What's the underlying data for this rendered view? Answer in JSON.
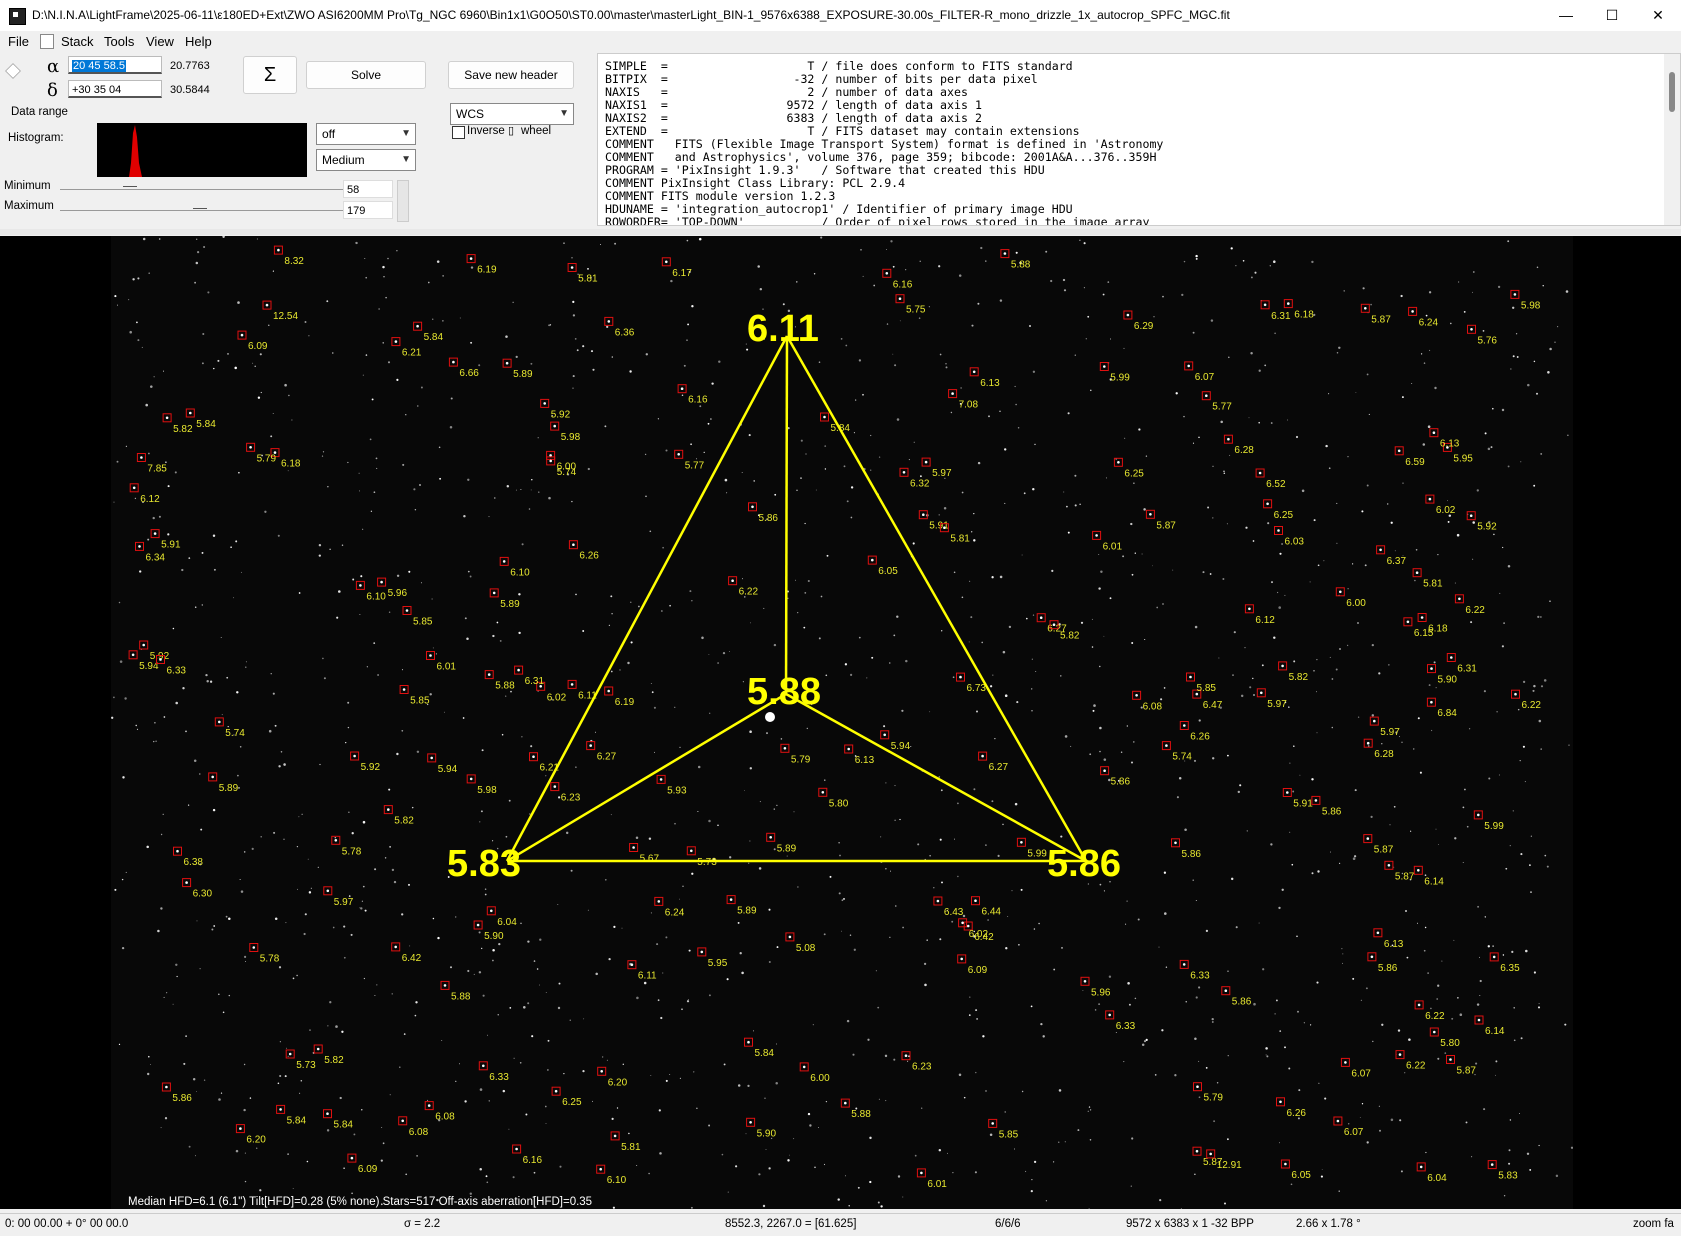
{
  "window": {
    "title": "D:\\N.I.N.A\\LightFrame\\2025-06-11\\ε180ED+Ext\\ZWO ASI6200MM Pro\\Tg_NGC 6960\\Bin1x1\\G0O50\\ST0.00\\master\\masterLight_BIN-1_9576x6388_EXPOSURE-30.00s_FILTER-R_mono_drizzle_1x_autocrop_SPFC_MGC.fit",
    "minimize": "—",
    "maximize": "☐",
    "close": "✕"
  },
  "menu": {
    "file": "File",
    "stack": "Stack",
    "tools": "Tools",
    "view": "View",
    "help": "Help"
  },
  "coords": {
    "alpha_symbol": "α",
    "delta_symbol": "δ",
    "ra_value": "20 45 58.5",
    "ra_deg": "20.7763",
    "dec_value": "+30 35 04",
    "dec_deg": "30.5844"
  },
  "buttons": {
    "sigma": "Σ",
    "solve": "Solve",
    "save_header": "Save new header"
  },
  "wcs_select": "WCS",
  "data_range": {
    "title": "Data range",
    "histogram_label": "Histogram:",
    "stretch": "off",
    "level": "Medium",
    "inverse_label": "Inverse",
    "wheel_label": "wheel",
    "minimum_label": "Minimum",
    "minimum_value": "58",
    "maximum_label": "Maximum",
    "maximum_value": "179"
  },
  "fits_header": [
    "SIMPLE  =                    T / file does conform to FITS standard",
    "BITPIX  =                  -32 / number of bits per data pixel",
    "NAXIS   =                    2 / number of data axes",
    "NAXIS1  =                 9572 / length of data axis 1",
    "NAXIS2  =                 6383 / length of data axis 2",
    "EXTEND  =                    T / FITS dataset may contain extensions",
    "COMMENT   FITS (Flexible Image Transport System) format is defined in 'Astronomy",
    "COMMENT   and Astrophysics', volume 376, page 359; bibcode: 2001A&A...376..359H",
    "PROGRAM = 'PixInsight 1.9.3'   / Software that created this HDU",
    "COMMENT PixInsight Class Library: PCL 2.9.4",
    "COMMENT FITS module version 1.2.3",
    "HDUNAME = 'integration_autocrop1' / Identifier of primary image HDU",
    "ROWORDER= 'TOP-DOWN'           / Order of pixel rows stored in the image array"
  ],
  "tilt": {
    "top_value": "6.11",
    "center_value": "5.88",
    "left_value": "5.83",
    "right_value": "5.86",
    "line_color": "#ffff00"
  },
  "star_labels": [
    "6.05",
    "6.44",
    "6.32",
    "6.33",
    "6.52",
    "6.26",
    "6.22",
    "6.10",
    "6.84",
    "6.73",
    "6.09",
    "6.23",
    "6.22",
    "6.59",
    "6.30",
    "6.42",
    "6.43",
    "6.12",
    "5.82",
    "6.02",
    "6.01",
    "6.18",
    "6.17",
    "6.07",
    "6.00",
    "6.13",
    "6.47",
    "6.23",
    "6.31",
    "6.34",
    "6.27",
    "6.29",
    "6.21",
    "5.87",
    "5.98",
    "5.92",
    "5.96",
    "5.94",
    "6.36",
    "6.42",
    "6.22",
    "6.31",
    "6.13",
    "6.18",
    "5.98",
    "6.08",
    "6.01",
    "6.03",
    "5.89",
    "5.88",
    "5.84",
    "5.91",
    "6.26",
    "6.28",
    "6.19",
    "6.09",
    "6.24",
    "6.16",
    "6.07",
    "6.22",
    "5.93",
    "5.86",
    "5.81",
    "5.85",
    "5.90",
    "6.37",
    "6.33",
    "6.20",
    "6.12",
    "5.80",
    "6.02",
    "5.97",
    "5.89",
    "5.84",
    "5.92",
    "6.04",
    "5.97",
    "6.09",
    "6.21",
    "6.25",
    "6.16",
    "5.87",
    "5.97",
    "5.89",
    "5.75",
    "6.04",
    "5.86",
    "5.73",
    "5.94",
    "6.35",
    "6.15",
    "6.27",
    "8.32",
    "6.33",
    "6.01",
    "5.86",
    "5.79",
    "5.87",
    "5.88",
    "5.94",
    "5.78",
    "5.95",
    "5.92",
    "6.14",
    "6.18",
    "6.27",
    "6.25",
    "5.95",
    "6.08",
    "5.67",
    "5.87",
    "5.85",
    "5.81",
    "5.86",
    "5.85",
    "5.91",
    "5.83",
    "6.22",
    "6.14",
    "6.11",
    "6.00",
    "5.84",
    "5.86",
    "5.77",
    "5.84",
    "6.11",
    "5.08",
    "5.88",
    "5.82",
    "5.79",
    "6.10",
    "6.28",
    "6.05",
    "6.10",
    "5.82",
    "5.81",
    "5.90",
    "5.87",
    "5.89",
    "5.87",
    "5.92",
    "5.97",
    "5.99",
    "6.38",
    "6.13",
    "5.96",
    "5.98",
    "5.74",
    "5.77",
    "5.76",
    "5.80",
    "5.74",
    "5.86",
    "5.82",
    "5.90",
    "5.91",
    "6.33",
    "6.31",
    "6.19",
    "5.89",
    "5.84",
    "5.86",
    "5.73",
    "5.81",
    "5.74",
    "5.82",
    "5.99",
    "6.07",
    "6.00",
    "6.25",
    "6.24",
    "6.16",
    "6.13",
    "6.02",
    "5.78",
    "5.79",
    "5.88",
    "6.26",
    "6.20",
    "5.84",
    "5.85",
    "12.91",
    "7.08",
    "7.85",
    "12.54",
    "6.66",
    "6.08",
    "5.99"
  ],
  "info_overlay": "Median HFD=6.1 (6.1\")  Tilt[HFD]=0.28 (5% none)  Stars=517  Off-axis aberration[HFD]=0.35",
  "status": {
    "coords": "0: 00  00.00  + 0° 00  00.0",
    "sigma": "σ = 2.2",
    "pixel": "8552.3, 2267.0 = [61.625]",
    "count": "6/6/6",
    "size": "9572 x 6383 x 1   -32 BPP",
    "scale": "2.66 x 1.78 °",
    "zoom": "zoom fa"
  }
}
